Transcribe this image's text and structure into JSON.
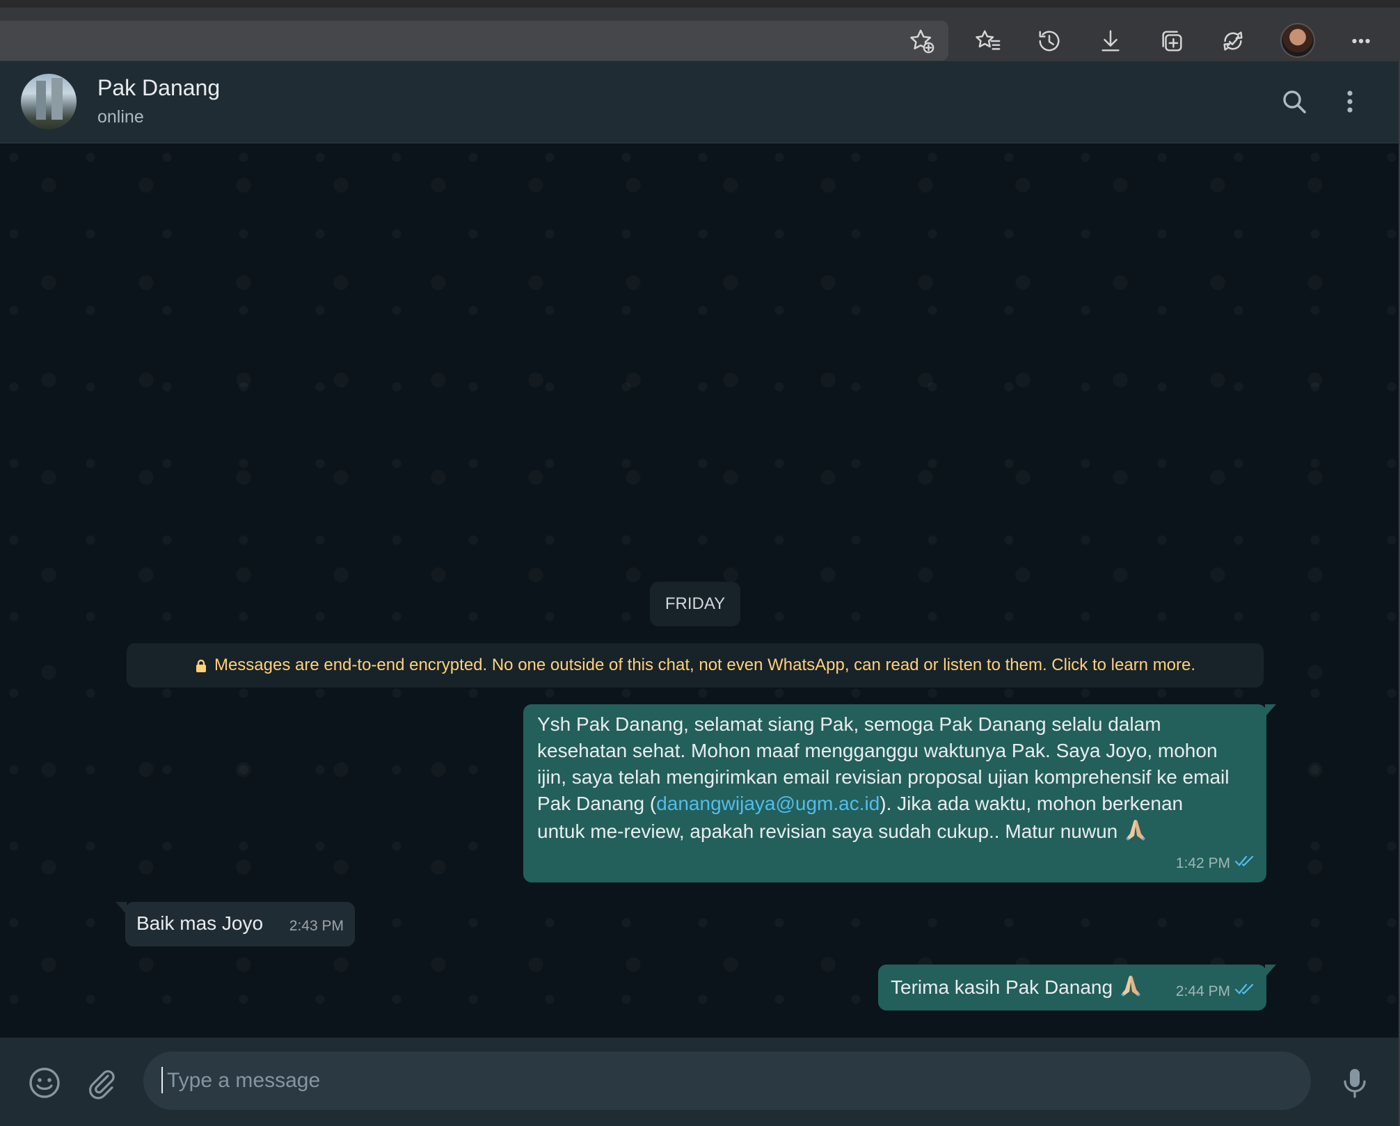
{
  "browser": {
    "toolbar_icons": [
      "add-favorite-icon",
      "favorites-icon",
      "history-icon",
      "downloads-icon",
      "collections-icon",
      "browser-essentials-icon",
      "profile-avatar",
      "more-menu-icon"
    ]
  },
  "header": {
    "contact_name": "Pak Danang",
    "status": "online",
    "icons": [
      "search-icon",
      "menu-icon"
    ]
  },
  "chat": {
    "date_label": "FRIDAY",
    "encryption_notice": "Messages are end-to-end encrypted. No one outside of this chat, not even WhatsApp, can read or listen to them. Click to learn more.",
    "messages": [
      {
        "direction": "outgoing",
        "line1": "Ysh Pak Danang, selamat siang Pak, semoga Pak Danang selalu dalam",
        "line2": "kesehatan sehat. Mohon maaf mengganggu  waktunya Pak. Saya Joyo, mohon",
        "line3": "ijin, saya telah mengirimkan email revisian proposal ujian komprehensif ke email",
        "line4_before": "Pak Danang (",
        "line4_link": "danangwijaya@ugm.ac.id",
        "line4_after": "). Jika ada waktu, mohon berkenan",
        "line5": "untuk me-review, apakah revisian saya sudah cukup.. Matur nuwun",
        "emoji": "folded-hands",
        "time": "1:42 PM",
        "status": "read"
      },
      {
        "direction": "incoming",
        "text": "Baik mas Joyo",
        "time": "2:43 PM"
      },
      {
        "direction": "outgoing",
        "text": "Terima kasih Pak Danang",
        "emoji": "folded-hands",
        "time": "2:44 PM",
        "status": "read"
      }
    ]
  },
  "composer": {
    "placeholder": "Type a message",
    "value": "",
    "icons": [
      "emoji-icon",
      "attach-icon",
      "microphone-icon"
    ]
  },
  "colors": {
    "background": "#0b141a",
    "header": "#202c33",
    "outgoing_bubble": "#235f5b",
    "incoming_bubble": "#202c33",
    "notice_text": "#ffd279",
    "link": "#53bdeb",
    "read_ticks": "#53bdeb"
  }
}
